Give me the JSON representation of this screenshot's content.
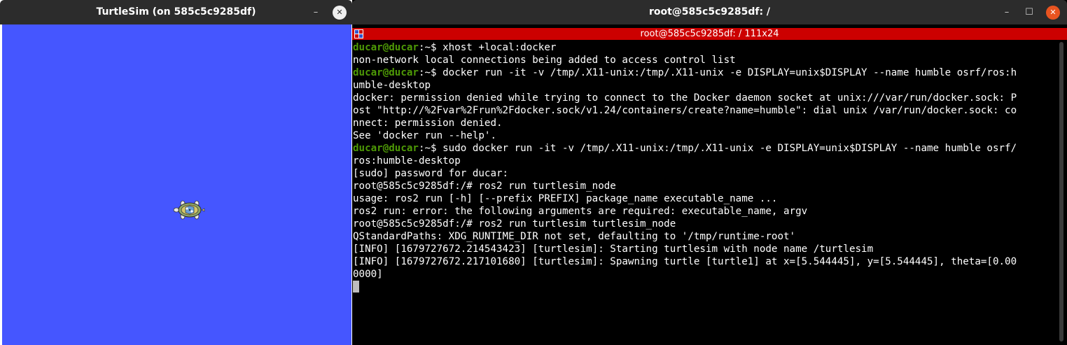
{
  "turtlesim": {
    "title": "TurtleSim (on 585c5c9285df)",
    "minimize_glyph": "–",
    "close_glyph": "✕",
    "background_color": "#4556ff",
    "turtle_icon": "turtle-icon"
  },
  "terminal": {
    "title": "root@585c5c9285df: /",
    "tab_title": "root@585c5c9285df: / 111x24",
    "minimize_glyph": "–",
    "maximize_glyph": "☐",
    "close_glyph": "✕",
    "accent_color": "#cc0000",
    "prompt_color": "#4e9a06",
    "lines": [
      {
        "prompt": "ducar@ducar",
        "suffix": ":~$ ",
        "text": "xhost +local:docker"
      },
      {
        "text": "non-network local connections being added to access control list"
      },
      {
        "prompt": "ducar@ducar",
        "suffix": ":~$ ",
        "text": "docker run -it -v /tmp/.X11-unix:/tmp/.X11-unix -e DISPLAY=unix$DISPLAY --name humble osrf/ros:h"
      },
      {
        "text": "umble-desktop"
      },
      {
        "text": "docker: permission denied while trying to connect to the Docker daemon socket at unix:///var/run/docker.sock: P"
      },
      {
        "text": "ost \"http://%2Fvar%2Frun%2Fdocker.sock/v1.24/containers/create?name=humble\": dial unix /var/run/docker.sock: co"
      },
      {
        "text": "nnect: permission denied."
      },
      {
        "text": "See 'docker run --help'."
      },
      {
        "prompt": "ducar@ducar",
        "suffix": ":~$ ",
        "text": "sudo docker run -it -v /tmp/.X11-unix:/tmp/.X11-unix -e DISPLAY=unix$DISPLAY --name humble osrf/"
      },
      {
        "text": "ros:humble-desktop"
      },
      {
        "text": "[sudo] password for ducar:"
      },
      {
        "text": "root@585c5c9285df:/# ros2 run turtlesim_node"
      },
      {
        "text": "usage: ros2 run [-h] [--prefix PREFIX] package_name executable_name ..."
      },
      {
        "text": "ros2 run: error: the following arguments are required: executable_name, argv"
      },
      {
        "text": "root@585c5c9285df:/# ros2 run turtlesim turtlesim_node"
      },
      {
        "text": "QStandardPaths: XDG_RUNTIME_DIR not set, defaulting to '/tmp/runtime-root'"
      },
      {
        "text": "[INFO] [1679727672.214543423] [turtlesim]: Starting turtlesim with node name /turtlesim"
      },
      {
        "text": "[INFO] [1679727672.217101680] [turtlesim]: Spawning turtle [turtle1] at x=[5.544445], y=[5.544445], theta=[0.00"
      },
      {
        "text": "0000]"
      }
    ]
  }
}
